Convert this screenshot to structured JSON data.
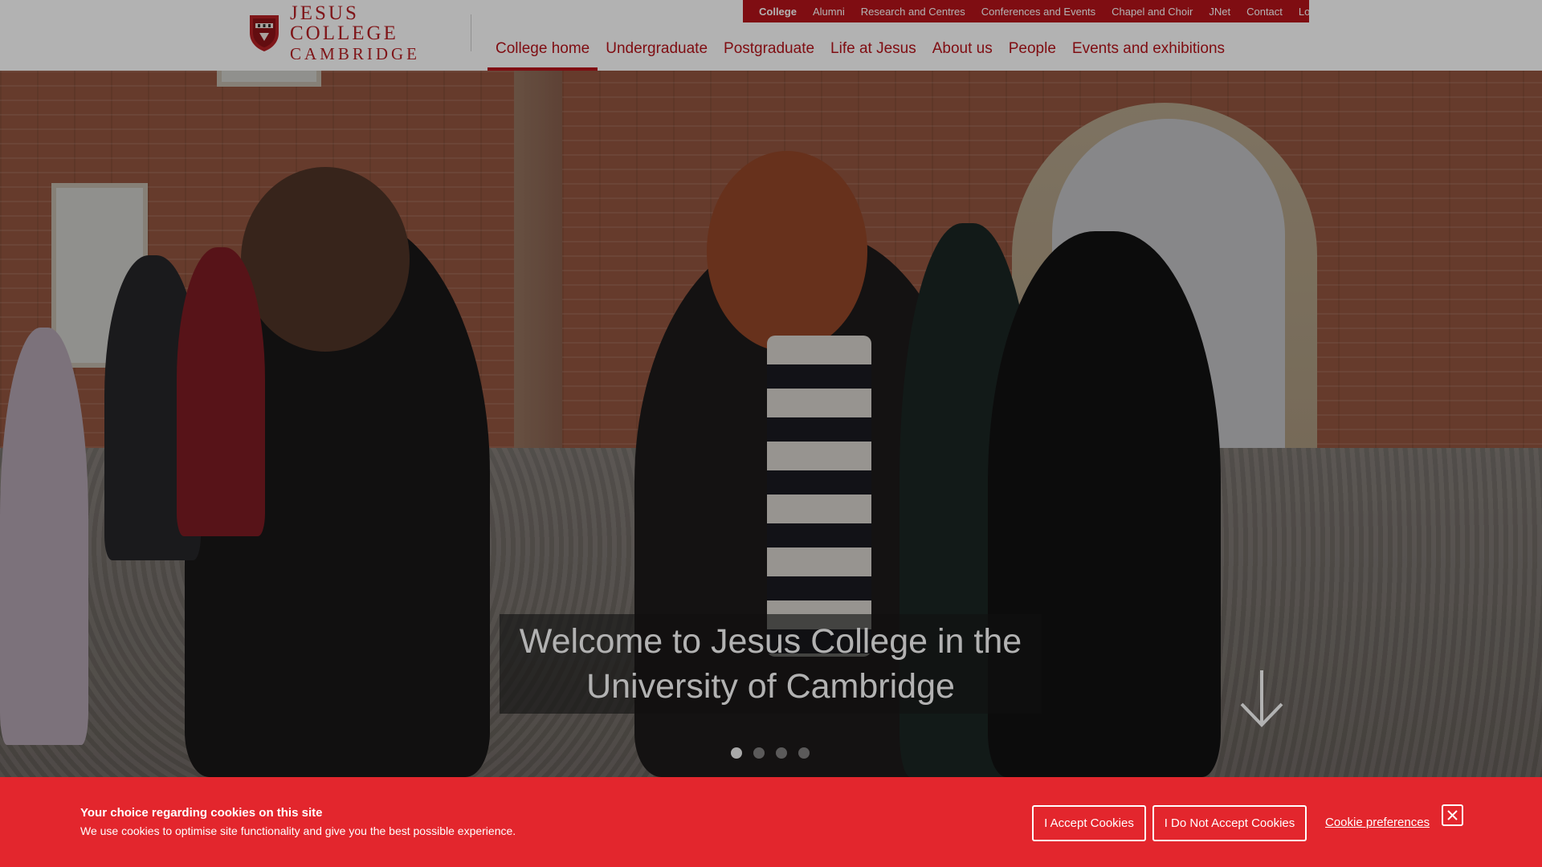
{
  "brand": {
    "line1": "Jesus College",
    "line2": "Cambridge",
    "color": "#b7141b"
  },
  "utility_nav": {
    "items": [
      {
        "label": "College",
        "active": true
      },
      {
        "label": "Alumni"
      },
      {
        "label": "Research and Centres"
      },
      {
        "label": "Conferences and Events"
      },
      {
        "label": "Chapel and Choir"
      },
      {
        "label": "JNet"
      },
      {
        "label": "Contact"
      },
      {
        "label": "Log in"
      }
    ],
    "search_icon": "search-icon"
  },
  "main_nav": {
    "items": [
      {
        "label": "College home",
        "active": true
      },
      {
        "label": "Undergraduate"
      },
      {
        "label": "Postgraduate"
      },
      {
        "label": "Life at Jesus"
      },
      {
        "label": "About us"
      },
      {
        "label": "People"
      },
      {
        "label": "Events and exhibitions"
      }
    ]
  },
  "hero": {
    "caption": "Welcome to Jesus College in the University of Cambridge",
    "slide_count": 4,
    "active_slide": 1,
    "scroll_icon": "arrow-down-icon"
  },
  "cookie_banner": {
    "title": "Your choice regarding cookies on this site",
    "description": "We use cookies to optimise site functionality and give you the best possible experience.",
    "accept_label": "I Accept Cookies",
    "decline_label": "I Do Not Accept Cookies",
    "preferences_label": "Cookie preferences",
    "close_icon": "close-icon",
    "background": "#e3262d"
  }
}
